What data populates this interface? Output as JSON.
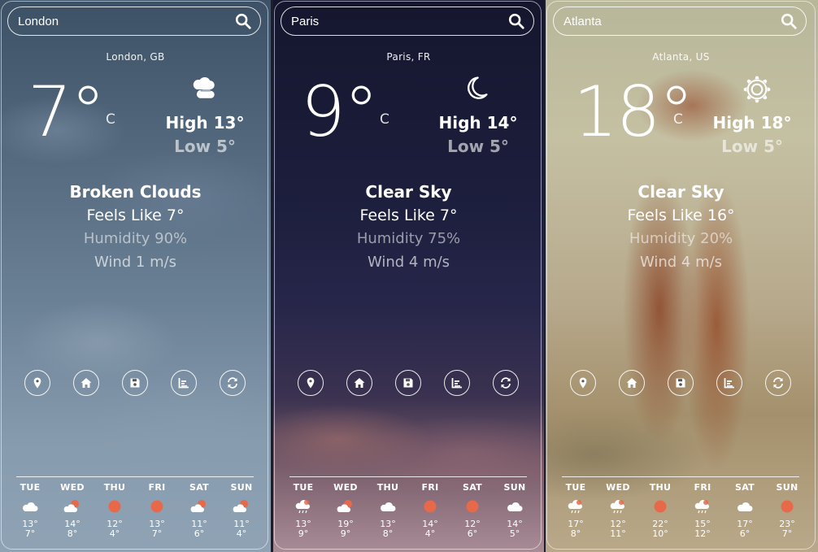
{
  "colors": {
    "sun": "#e8694a",
    "text": "#ffffff"
  },
  "cards": [
    {
      "search_value": "London",
      "location": "London, GB",
      "temp": "7°",
      "unit": "C",
      "condition_icon": "broken-clouds-icon",
      "high": "High 13°",
      "low": "Low 5°",
      "description": "Broken Clouds",
      "feels_like": "Feels Like 7°",
      "humidity": "Humidity 90%",
      "wind": "Wind 1 m/s",
      "forecast": [
        {
          "day": "TUE",
          "icon": "cloud-icon",
          "high": "13°",
          "low": "7°"
        },
        {
          "day": "WED",
          "icon": "sun-cloud-icon",
          "high": "14°",
          "low": "8°"
        },
        {
          "day": "THU",
          "icon": "sun-icon",
          "high": "12°",
          "low": "4°"
        },
        {
          "day": "FRI",
          "icon": "sun-icon",
          "high": "13°",
          "low": "7°"
        },
        {
          "day": "SAT",
          "icon": "sun-cloud-icon",
          "high": "11°",
          "low": "6°"
        },
        {
          "day": "SUN",
          "icon": "sun-cloud-icon",
          "high": "11°",
          "low": "4°"
        }
      ]
    },
    {
      "search_value": "Paris",
      "location": "Paris, FR",
      "temp": "9°",
      "unit": "C",
      "condition_icon": "moon-icon",
      "high": "High 14°",
      "low": "Low 5°",
      "description": "Clear Sky",
      "feels_like": "Feels Like 7°",
      "humidity": "Humidity 75%",
      "wind": "Wind 4 m/s",
      "forecast": [
        {
          "day": "TUE",
          "icon": "rain-cloud-icon",
          "high": "13°",
          "low": "9°"
        },
        {
          "day": "WED",
          "icon": "sun-cloud-icon",
          "high": "19°",
          "low": "9°"
        },
        {
          "day": "THU",
          "icon": "cloud-icon",
          "high": "13°",
          "low": "8°"
        },
        {
          "day": "FRI",
          "icon": "sun-icon",
          "high": "14°",
          "low": "4°"
        },
        {
          "day": "SAT",
          "icon": "sun-icon",
          "high": "12°",
          "low": "6°"
        },
        {
          "day": "SUN",
          "icon": "cloud-icon",
          "high": "14°",
          "low": "5°"
        }
      ]
    },
    {
      "search_value": "Atlanta",
      "location": "Atlanta, US",
      "temp": "18°",
      "unit": "C",
      "condition_icon": "sun-outline-icon",
      "high": "High 18°",
      "low": "Low 5°",
      "description": "Clear Sky",
      "feels_like": "Feels Like 16°",
      "humidity": "Humidity 20%",
      "wind": "Wind 4 m/s",
      "forecast": [
        {
          "day": "TUE",
          "icon": "rain-cloud-icon",
          "high": "17°",
          "low": "8°"
        },
        {
          "day": "WED",
          "icon": "rain-cloud-icon",
          "high": "12°",
          "low": "11°"
        },
        {
          "day": "THU",
          "icon": "sun-icon",
          "high": "22°",
          "low": "10°"
        },
        {
          "day": "FRI",
          "icon": "rain-cloud-icon",
          "high": "15°",
          "low": "12°"
        },
        {
          "day": "SAT",
          "icon": "cloud-icon",
          "high": "17°",
          "low": "6°"
        },
        {
          "day": "SUN",
          "icon": "sun-icon",
          "high": "23°",
          "low": "7°"
        }
      ]
    }
  ]
}
